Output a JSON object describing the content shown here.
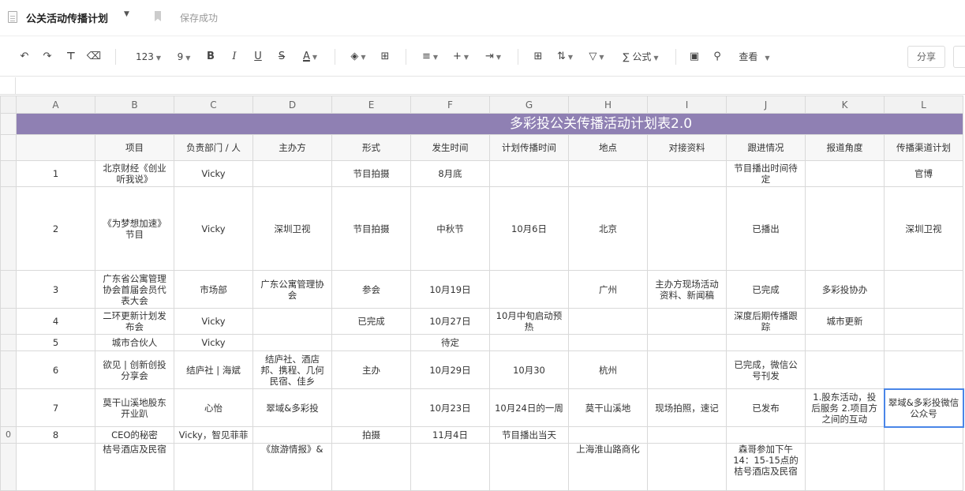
{
  "titlebar": {
    "doc_title": "公关活动传播计划",
    "save_status": "保存成功"
  },
  "toolbar": {
    "format_label": "123",
    "font_size": "9",
    "bold": "B",
    "italic": "I",
    "underline": "U",
    "strike": "S",
    "font_color": "A",
    "formula_label": "∑ 公式",
    "view_label": "查看",
    "share_label": "分享"
  },
  "columns": [
    "A",
    "B",
    "C",
    "D",
    "E",
    "F",
    "G",
    "H",
    "I",
    "J",
    "K",
    "L"
  ],
  "sheet_title": "多彩投公关传播活动计划表2.0",
  "headers": [
    "",
    "项目",
    "负责部门 / 人",
    "主办方",
    "形式",
    "发生时间",
    "计划传播时间",
    "地点",
    "对接资料",
    "跟进情况",
    "报道角度",
    "传播渠道计划"
  ],
  "rows": [
    {
      "row_label": "",
      "cells": [
        "1",
        "北京财经《创业听我说》",
        "Vicky",
        "",
        "节目拍摄",
        "8月底",
        "",
        "",
        "",
        "节目播出时间待定",
        "",
        "官博"
      ]
    },
    {
      "row_label": "",
      "cells": [
        "2",
        "《为梦想加速》节目",
        "Vicky",
        "深圳卫视",
        "节目拍摄",
        "中秋节",
        "10月6日",
        "北京",
        "",
        "已播出",
        "",
        "深圳卫视"
      ]
    },
    {
      "row_label": "",
      "cells": [
        "3",
        "广东省公寓管理协会首届会员代表大会",
        "市场部",
        "广东公寓管理协会",
        "参会",
        "10月19日",
        "",
        "广州",
        "主办方现场活动资料、新闻稿",
        "已完成",
        "多彩投协办",
        ""
      ]
    },
    {
      "row_label": "",
      "cells": [
        "4",
        "二环更新计划发布会",
        "Vicky",
        "",
        "已完成",
        "10月27日",
        "10月中旬启动预热",
        "",
        "",
        "深度后期传播跟踪",
        "城市更新",
        ""
      ]
    },
    {
      "row_label": "",
      "cells": [
        "5",
        "城市合伙人",
        "Vicky",
        "",
        "",
        "待定",
        "",
        "",
        "",
        "",
        "",
        ""
      ]
    },
    {
      "row_label": "",
      "cells": [
        "6",
        "欲见 | 创新创投分享会",
        "结庐社 | 海斌",
        "结庐社、酒店邦、携程、几何民宿、佳乡",
        "主办",
        "10月29日",
        "10月30",
        "杭州",
        "",
        "已完成，微信公号刊发",
        "",
        ""
      ]
    },
    {
      "row_label": "",
      "cells": [
        "7",
        "莫干山溪地股东开业趴",
        "心怡",
        "翠域&多彩投",
        "",
        "10月23日",
        "10月24日的一周",
        "莫干山溪地",
        "现场拍照，速记",
        "已发布",
        "1.股东活动，投后服务 2.项目方之间的互动",
        "翠域&多彩投微信公众号"
      ]
    },
    {
      "row_label": "0",
      "cells": [
        "8",
        "CEO的秘密",
        "Vicky，智见菲菲",
        "",
        "拍摄",
        "11月4日",
        "节目播出当天",
        "",
        "",
        "",
        "",
        ""
      ]
    },
    {
      "row_label": "",
      "cells": [
        "",
        "桔号酒店及民宿",
        "",
        "《旅游情报》&",
        "",
        "",
        "",
        "上海淮山路商化",
        "",
        "森哥参加下午14：15-15点的桔号酒店及民宿",
        "",
        ""
      ]
    }
  ]
}
